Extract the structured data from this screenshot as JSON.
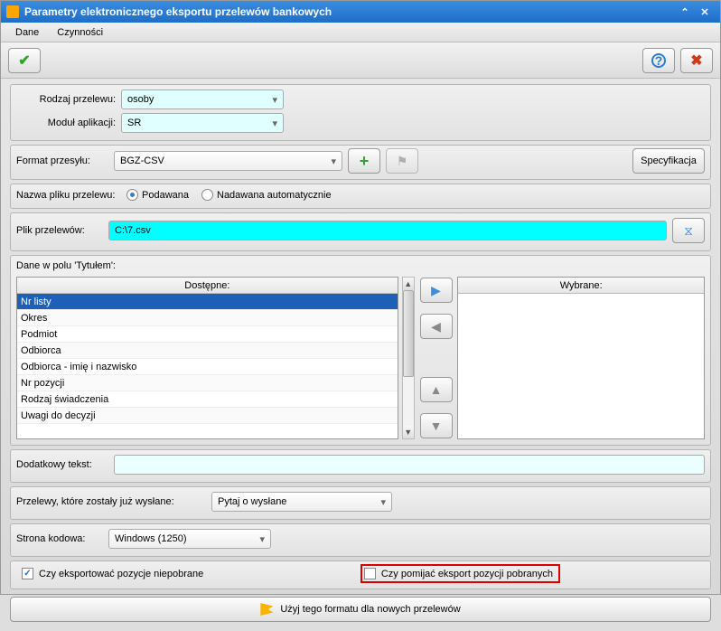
{
  "window": {
    "title": "Parametry elektronicznego eksportu przelewów bankowych"
  },
  "menu": {
    "dane": "Dane",
    "czynnosci": "Czynności"
  },
  "labels": {
    "rodzaj_przelewu": "Rodzaj przelewu:",
    "modul_aplikacji": "Moduł aplikacji:",
    "format_przesylu": "Format przesyłu:",
    "nazwa_pliku": "Nazwa pliku przelewu:",
    "plik_przelewow": "Plik przelewów:",
    "dane_w_polu": "Dane w polu 'Tytułem':",
    "dodatkowy_tekst": "Dodatkowy tekst:",
    "przelewy_wyslane": "Przelewy, które zostały już wysłane:",
    "strona_kodowa": "Strona kodowa:"
  },
  "values": {
    "rodzaj_przelewu": "osoby",
    "modul_aplikacji": "SR",
    "format_przesylu": "BGZ-CSV",
    "plik_przelewow": "C:\\7.csv",
    "dodatkowy_tekst": "",
    "przelewy_wyslane": "Pytaj o wysłane",
    "strona_kodowa": "Windows (1250)"
  },
  "radio": {
    "podawana": "Podawana",
    "nadawana": "Nadawana automatycznie"
  },
  "buttons": {
    "specyfikacja": "Specyfikacja",
    "uzyj_formatu": "Użyj tego formatu dla nowych przelewów"
  },
  "picker": {
    "dostepne_header": "Dostępne:",
    "wybrane_header": "Wybrane:",
    "dostepne": [
      "Nr listy",
      "Okres",
      "Podmiot",
      "Odbiorca",
      "Odbiorca - imię i nazwisko",
      "Nr pozycji",
      "Rodzaj świadczenia",
      "Uwagi do decyzji"
    ]
  },
  "checkboxes": {
    "eksportowac_niepobrane": "Czy eksportować pozycje niepobrane",
    "pomijac_pobrane": "Czy pomijać eksport pozycji pobranych"
  }
}
